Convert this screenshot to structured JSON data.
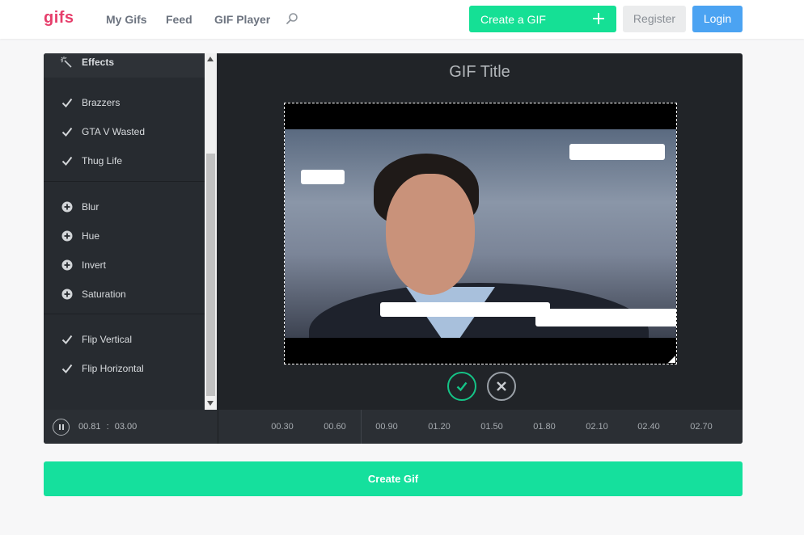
{
  "header": {
    "logo": "gifs",
    "nav": [
      {
        "label": "My Gifs"
      },
      {
        "label": "Feed"
      },
      {
        "label": "GIF Player"
      }
    ],
    "create_label": "Create a GIF",
    "register_label": "Register",
    "login_label": "Login"
  },
  "sidebar": {
    "header_label": "Effects",
    "groups": [
      [
        {
          "label": "Brazzers",
          "icon": "check-icon",
          "state": "applied"
        },
        {
          "label": "GTA V Wasted",
          "icon": "check-icon",
          "state": "applied"
        },
        {
          "label": "Thug Life",
          "icon": "check-icon",
          "state": "applied"
        }
      ],
      [
        {
          "label": "Blur",
          "icon": "plus-circle-icon",
          "state": "add"
        },
        {
          "label": "Hue",
          "icon": "plus-circle-icon",
          "state": "add"
        },
        {
          "label": "Invert",
          "icon": "plus-circle-icon",
          "state": "add"
        },
        {
          "label": "Saturation",
          "icon": "plus-circle-icon",
          "state": "add"
        }
      ],
      [
        {
          "label": "Flip Vertical",
          "icon": "check-icon",
          "state": "applied"
        },
        {
          "label": "Flip Horizontal",
          "icon": "check-icon",
          "state": "applied"
        }
      ]
    ]
  },
  "editor": {
    "gif_title": "GIF Title"
  },
  "timeline": {
    "current": "00.81",
    "separator": ":",
    "total": "03.00",
    "ticks": [
      "00.30",
      "00.60",
      "00.90",
      "01.20",
      "01.50",
      "01.80",
      "02.10",
      "02.40",
      "02.70"
    ]
  },
  "footer": {
    "create_gif_label": "Create Gif"
  },
  "colors": {
    "brand": "#e63e6b",
    "accent_green": "#15e095",
    "login_blue": "#4ba3f2",
    "editor_bg": "#212428"
  }
}
